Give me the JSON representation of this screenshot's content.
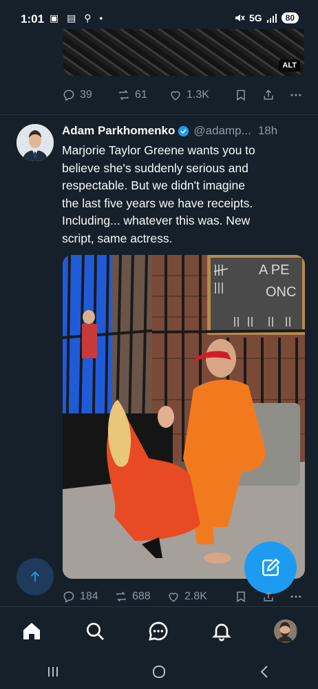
{
  "status_bar": {
    "time": "1:01",
    "left_icons": "▣ ▤ ⚲ •",
    "network": "5G",
    "battery": "80"
  },
  "previous_tweet": {
    "alt_badge": "ALT",
    "actions": {
      "replies": "39",
      "reposts": "61",
      "likes": "1.3K"
    }
  },
  "tweet": {
    "author_name": "Adam Parkhomenko",
    "handle": "@adamp...",
    "time": "18h",
    "text": "Marjorie Taylor Greene wants you to\nbelieve she's suddenly serious and\nrespectable. But we didn't imagine\nthe last five years we have receipts.\nIncluding... whatever this was. New\nscript, same actress.",
    "photo_chalk_top": "A PE",
    "photo_chalk_mid": "ONC",
    "actions": {
      "replies": "184",
      "reposts": "688",
      "likes": "2.8K"
    }
  },
  "icons": {
    "verified": "verified-badge-icon",
    "compose": "compose-icon",
    "scroll_top": "arrow-up-icon",
    "home": "home-icon",
    "search": "search-icon",
    "grok": "chat-icon",
    "notifications": "bell-icon",
    "profile": "profile-avatar"
  },
  "colors": {
    "background": "#15202b",
    "accent": "#1d9bf0",
    "muted": "#8b98a5"
  }
}
